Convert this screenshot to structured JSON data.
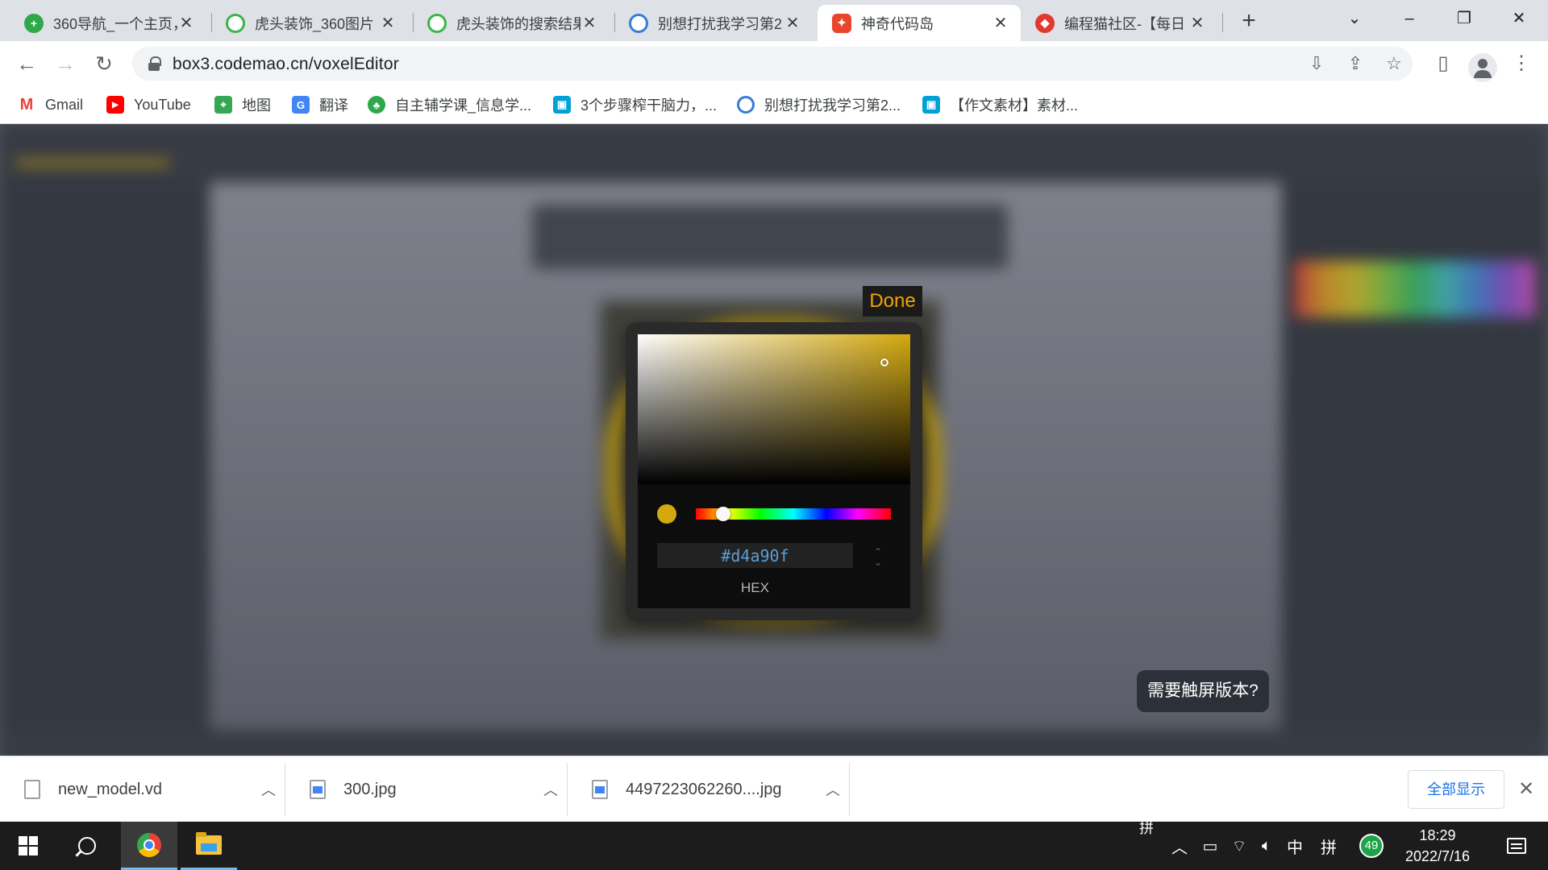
{
  "browser": {
    "tabs": [
      {
        "title": "360导航_一个主页，",
        "favicon": "360-icon",
        "color": "#2ea84a"
      },
      {
        "title": "虎头装饰_360图片",
        "favicon": "360-image-icon",
        "color": "#3bb54a"
      },
      {
        "title": "虎头装饰的搜索结果",
        "favicon": "360-image-icon",
        "color": "#3bb54a"
      },
      {
        "title": "别想打扰我学习第2",
        "favicon": "study-icon",
        "color": "#3a7bd5"
      },
      {
        "title": "神奇代码岛",
        "favicon": "codemao-icon",
        "color": "#e8452c"
      },
      {
        "title": "编程猫社区-【每日",
        "favicon": "codemao-cat-icon",
        "color": "#e03a2f"
      }
    ],
    "url": "box3.codemao.cn/voxelEditor",
    "bookmarks": [
      {
        "label": "Gmail",
        "icon": "gmail-icon",
        "color": "#ea4335"
      },
      {
        "label": "YouTube",
        "icon": "youtube-icon",
        "color": "#ff0000"
      },
      {
        "label": "地图",
        "icon": "maps-icon",
        "color": "#34a853"
      },
      {
        "label": "翻译",
        "icon": "translate-icon",
        "color": "#4285f4"
      },
      {
        "label": "自主辅学课_信息学...",
        "icon": "leaf-icon",
        "color": "#2ea84a"
      },
      {
        "label": "3个步骤榨干脑力，...",
        "icon": "bilibili-icon",
        "color": "#00a1d6"
      },
      {
        "label": "别想打扰我学习第2...",
        "icon": "study-icon",
        "color": "#3a7bd5"
      },
      {
        "label": "【作文素材】素材...",
        "icon": "bilibili-icon",
        "color": "#00a1d6"
      }
    ]
  },
  "picker": {
    "done_label": "Done",
    "hex_value": "#d4a90f",
    "mode_label": "HEX",
    "selected_color": "#d4a90f"
  },
  "editor": {
    "touch_tip": "需要触屏版本?"
  },
  "downloads": {
    "items": [
      {
        "name": "new_model.vd",
        "icon": "file-icon"
      },
      {
        "name": "300.jpg",
        "icon": "image-file-icon"
      },
      {
        "name": "4497223062260....jpg",
        "icon": "image-file-icon"
      }
    ],
    "show_all_label": "全部显示"
  },
  "taskbar": {
    "ime_top": "拼",
    "ime_mode": "中",
    "ime_layout": "拼",
    "badge_count": "49",
    "time": "18:29",
    "date": "2022/7/16"
  }
}
